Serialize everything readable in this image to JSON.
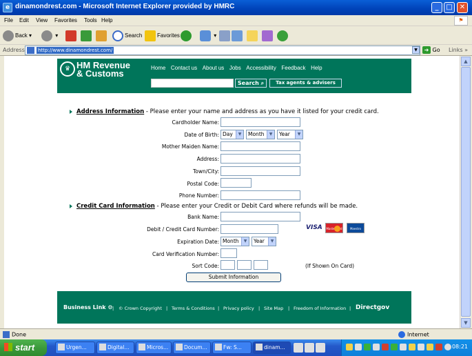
{
  "window": {
    "title": "dinamondrest.com - Microsoft Internet Explorer provided by HMRC",
    "minimize": "_",
    "maximize": "□",
    "close": "✕"
  },
  "menu": [
    "File",
    "Edit",
    "View",
    "Favorites",
    "Tools",
    "Help"
  ],
  "toolbar": {
    "back": "Back",
    "search": "Search",
    "favorites": "Favorites"
  },
  "address": {
    "label": "Address",
    "url": "http://www.dinamondrest.com/",
    "go": "Go",
    "links": "Links"
  },
  "hmrc": {
    "name_line1": "HM Revenue",
    "name_line2": "& Customs",
    "nav": [
      "Home",
      "Contact us",
      "About us",
      "Jobs",
      "Accessibility",
      "Feedback",
      "Help"
    ],
    "search_button": "Search",
    "tax_agents": "Tax agents & advisers"
  },
  "form": {
    "address_section": {
      "heading": "Address Information",
      "text": " - Please enter your name and address as you have it listed for your credit card."
    },
    "labels": {
      "cardholder": "Cardholder Name:",
      "dob": "Date of Birth:",
      "maiden": "Mother Maiden Name:",
      "address": "Address:",
      "town": "Town/City:",
      "postal": "Postal Code:",
      "phone": "Phone Number:",
      "bank": "Bank Name:",
      "card_number": "Debit / Credit Card Number:",
      "expiry": "Expiration Date:",
      "cvn": "Card Verification Number:",
      "sort_code": "Sort Code:"
    },
    "dob_selects": {
      "day": "Day",
      "month": "Month",
      "year": "Year"
    },
    "credit_section": {
      "heading": "Credit Card Information",
      "text": " - Please enter your Credit or Debit Card where refunds will be made."
    },
    "expiry_selects": {
      "month": "Month",
      "year": "Year"
    },
    "card_logos": {
      "visa": "VISA",
      "mastercard": "MasterCard",
      "maestro": "Maestro"
    },
    "sort_code_note": "(If Shown On Card)",
    "submit": "Submit Information"
  },
  "footer": {
    "business_link": "Business Link",
    "links": [
      "© Crown Copyright",
      "Terms & Conditions",
      "Privacy policy",
      "Site Map",
      "Freedom of Information"
    ],
    "directgov": "Directgov"
  },
  "status": {
    "text": "Done",
    "zone": "Internet"
  },
  "taskbar": {
    "start": "start",
    "tasks": [
      "Urgen...",
      "Digital...",
      "Micros...",
      "Docum...",
      "Fw: S...",
      "dinam..."
    ],
    "clock": "08:21"
  }
}
